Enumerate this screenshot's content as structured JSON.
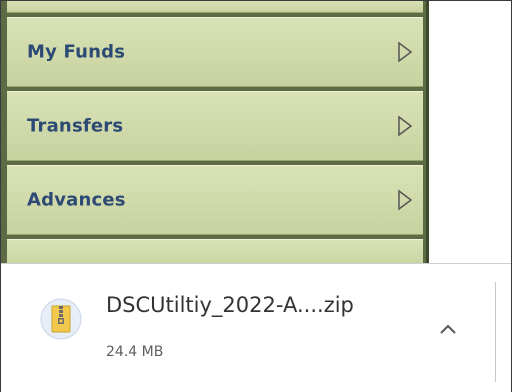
{
  "menu": {
    "items": [
      {
        "label": "My Funds",
        "icon": "chevron-right-icon"
      },
      {
        "label": "Transfers",
        "icon": "chevron-right-icon"
      },
      {
        "label": "Advances",
        "icon": "chevron-right-icon"
      }
    ]
  },
  "download": {
    "file_name": "DSCUtiltiy_2022-A....zip",
    "file_size": "24.4 MB",
    "file_icon": "zip-file-icon",
    "expand_icon": "chevron-up-icon"
  },
  "colors": {
    "menu_text": "#2c4a74",
    "menu_bg": "#d9e2b6",
    "menu_frame": "#5d6b45"
  }
}
